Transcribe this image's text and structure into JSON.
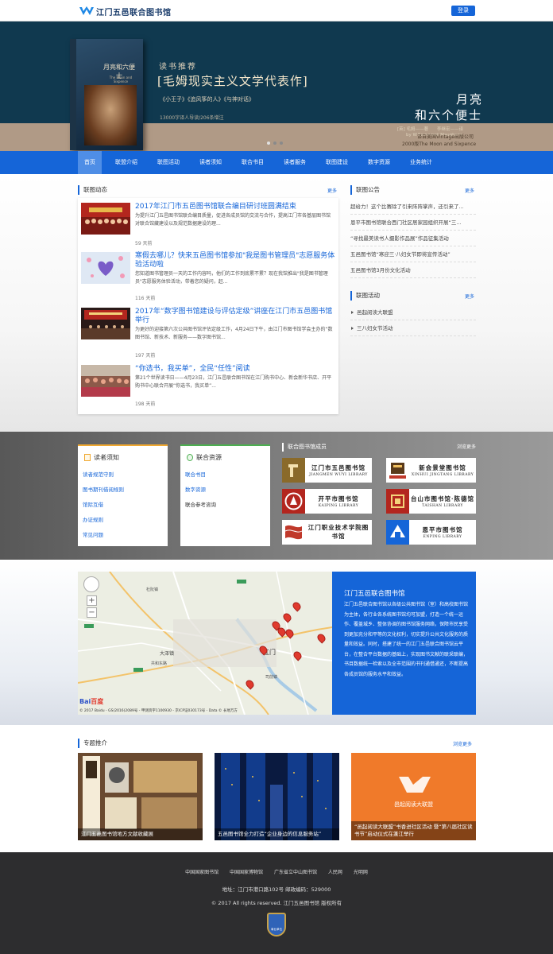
{
  "header": {
    "site_title": "江门五邑联合图书馆",
    "login_label": "登录"
  },
  "banner": {
    "tag": "读书推荐",
    "headline": "[毛姆现实主义文学代表作]",
    "works": "《小王子》《追风筝的人》《与神对话》",
    "meta": "13000字译人导读/206条增注",
    "book_title_1": "月亮",
    "book_title_2": "和六个便士",
    "author_line": "[英] 毛姆——著　　李继宏——译",
    "author_en": "by W.Somerset Maugham",
    "publisher": "译自美国Vintage出版公司",
    "edition": "2000版The Moon and Sixpence",
    "cover_title": "月亮和六便士",
    "cover_sub": "The Moon and Sixpence"
  },
  "nav": {
    "items": [
      "首页",
      "联盟介绍",
      "联图活动",
      "读者须知",
      "联合书目",
      "读者服务",
      "联图建设",
      "数字资源",
      "业务统计"
    ],
    "active_index": 0
  },
  "news": {
    "heading": "联图动态",
    "more": "更多",
    "items": [
      {
        "title": "2017年江门市五邑图书馆联合编目研讨班圆满结束",
        "desc": "为提升江门五邑图书馆联合编目质量，促进各成员馆的交流与合作，提高江门市各基层图书馆对联合馆藏建设以及规范数据建设的理...",
        "date": "59 天前"
      },
      {
        "title": "寒假去哪儿？快来五邑图书馆参加\"我是图书管理员\"志愿服务体验活动啦",
        "desc": "您知道图书管理员一天的工作内容吗，他们的工作到底累不累？现在我馆推出\"我是图书管理员\"志愿服务体验活动，带着您的疑问，赶...",
        "date": "116 天前"
      },
      {
        "title": "2017年“数字图书馆建设与评估定级”讲座在江门市五邑图书馆举行",
        "desc": "为更好的迎接第六次公共图书馆评估定级工作，4月24日下午，由江门市图书馆学会主办的“数图书馆、新技术、新服务——数字图书馆...",
        "date": "197 天前"
      },
      {
        "title": "“你选书，我买单”，全民“任性”阅读",
        "desc": "第21个世界读书日——4月23日，江门五邑联合图书馆在江门购书中心、新会新华书店、开平购书中心联合开展“你选书，我买单”...",
        "date": "198 天前"
      }
    ]
  },
  "announcements": {
    "heading": "联图公告",
    "more": "更多",
    "items": [
      "超给力！这个比赛除了引来阵阵掌声，还引来了...",
      "恩平市图书馆联合西门社区居家园组织开展“三...",
      "“寻找最美读书人摄影作品展”作品征集活动",
      "五邑图书馆“寒迎三·八妇女节即将宣传活动”",
      "五邑图书馆3月份文化活动"
    ]
  },
  "activities": {
    "heading": "联图活动",
    "more": "更多",
    "items": [
      "邑起阅读大联盟",
      "三八妇女节活动"
    ]
  },
  "reader_notice": {
    "heading": "读者须知",
    "items": [
      "读者规范守则",
      "图书期刊借阅规则",
      "馆际互借",
      "办证规则",
      "常见问题"
    ]
  },
  "resources": {
    "heading": "联合资源",
    "items": [
      "联合书目",
      "数字资源",
      "联合参考咨询"
    ]
  },
  "members": {
    "heading": "联合图书馆成员",
    "more": "浏览更多",
    "libs": [
      {
        "name": "江门市五邑图书馆",
        "en": "JIANGMEN WUYI LIBRARY"
      },
      {
        "name": "新会景堂图书馆",
        "en": "XINHUI JINGTANG LIBRARY"
      },
      {
        "name": "开平市图书馆",
        "en": "KAIPING LIBRARY"
      },
      {
        "name": "台山市图书馆·陈德馆",
        "en": "TAISHAN LIBRARY"
      },
      {
        "name": "江门职业技术学院图书馆",
        "en": ""
      },
      {
        "name": "恩平市图书馆",
        "en": "ENPING LIBRARY"
      }
    ]
  },
  "map_info": {
    "title": "江门五邑联合图书馆",
    "body": "江门五邑联合图书馆以各级公共图书馆（室）和高校图书馆为主体，各行业各系统图书馆均可加盟，打造一个统一运作、覆盖城乡、整体协调的图书馆服务网络，保障市民享受到更加充分和平等的文化权利，切实提升公共文化服务的质量和效益。同时，搭建了统一的江门五邑联合图书馆云平台，在整合平台数据的基础上，实现图书文献的联采联编，书目数据统一检索以及全市范围的书刊通借通还，不断提高各成员馆的服务水平和效益。",
    "map_labels": [
      "江门",
      "共和东路",
      "大泽镇",
      "杜阮镇",
      "司前镇"
    ],
    "baidu": "Bai",
    "baidu2": "百度",
    "copyright": "© 2017 Baidu - GS(2016)2089号 - 甲测资字1100930 - 京ICP证030173号 - Data © 长地万方"
  },
  "topics": {
    "heading": "专题推介",
    "more": "浏览更多",
    "items": [
      {
        "caption": "江门五邑图书馆地方文献收藏展"
      },
      {
        "caption": "五邑图书馆全力打造“企业身边的信息服务站”"
      },
      {
        "caption": "“邑起阅读大联盟”书香进社区活动 暨“第八届社区读书节”启动仪式在蓬江举行",
        "logo_text": "邑起阅读大联盟"
      }
    ]
  },
  "footer": {
    "links": [
      "中国国家图书馆",
      "中国国家博物馆",
      "广东省立中山图书馆",
      "人民网",
      "光明网"
    ],
    "address": "地址：江门市港口路102号  邮政编码：529000",
    "copyright": "© 2017 All rights reserved. 江门五邑图书馆 版权所有",
    "badge": "事业单位"
  }
}
